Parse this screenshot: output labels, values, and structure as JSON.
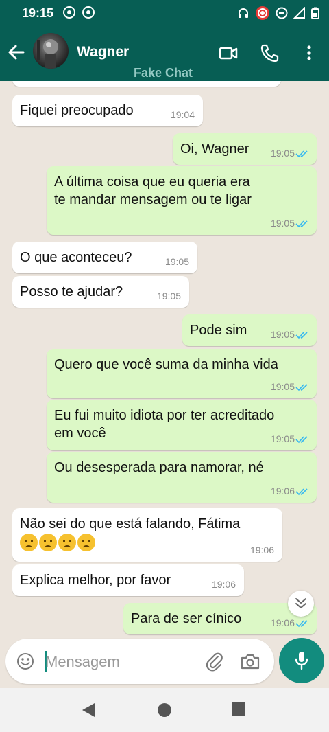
{
  "status_bar": {
    "time": "19:15"
  },
  "header": {
    "contact_name": "Wagner",
    "subtitle": "Fake Chat"
  },
  "messages": [
    {
      "dir": "in",
      "text": "Fiquei preocupado",
      "time": "19:04"
    },
    {
      "dir": "out",
      "text": "Oi, Wagner",
      "time": "19:05"
    },
    {
      "dir": "out",
      "text_line1": "A última coisa que eu queria era",
      "text_line2": "te mandar mensagem ou te ligar",
      "time": "19:05"
    },
    {
      "dir": "in",
      "text": "O que aconteceu?",
      "time": "19:05"
    },
    {
      "dir": "in",
      "text": "Posso te ajudar?",
      "time": "19:05"
    },
    {
      "dir": "out",
      "text": "Pode sim",
      "time": "19:05"
    },
    {
      "dir": "out",
      "text": "Quero que você suma da minha vida",
      "time": "19:05"
    },
    {
      "dir": "out",
      "text_line1": "Eu fui muito idiota por ter acreditado",
      "text_line2": "em você",
      "time": "19:05"
    },
    {
      "dir": "out",
      "text": "Ou desesperada para namorar, né",
      "time": "19:06"
    },
    {
      "dir": "in",
      "text": "Não sei do que está falando, Fátima",
      "emoji_count": 4,
      "time": "19:06"
    },
    {
      "dir": "in",
      "text": "Explica melhor, por favor",
      "time": "19:06"
    },
    {
      "dir": "out",
      "text": "Para de ser cínico",
      "time": "19:06"
    }
  ],
  "input": {
    "placeholder": "Mensagem"
  },
  "colors": {
    "header": "#075e54",
    "outgoing_bubble": "#dcf8c6",
    "incoming_bubble": "#ffffff",
    "accent": "#128c7e",
    "read_ticks": "#34b7f1"
  }
}
